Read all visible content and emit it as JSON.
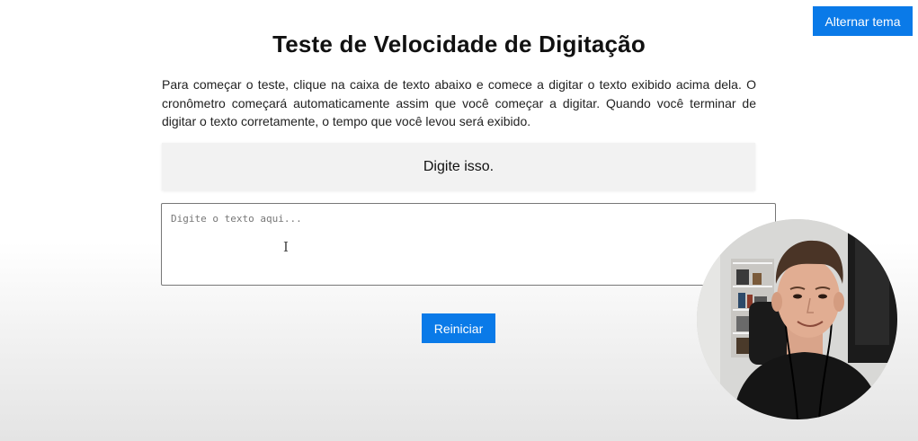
{
  "header": {
    "theme_toggle_label": "Alternar tema"
  },
  "page": {
    "title": "Teste de Velocidade de Digitação",
    "instructions": "Para começar o teste, clique na caixa de texto abaixo e comece a digitar o texto exibido acima dela. O cronômetro começará automaticamente assim que você começar a digitar. Quando você terminar de digitar o texto corretamente, o tempo que você levou será exibido.",
    "sample_text": "Digite isso.",
    "input": {
      "value": "",
      "placeholder": "Digite o texto aqui..."
    },
    "restart_label": "Reiniciar"
  },
  "icons": {
    "text_cursor": "I"
  },
  "colors": {
    "accent": "#0a7ae8",
    "sample_background": "#f2f2f2"
  }
}
